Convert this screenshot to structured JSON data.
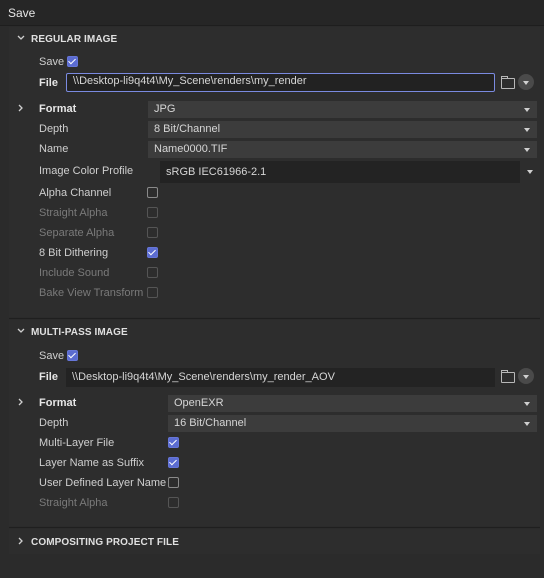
{
  "title": "Save",
  "regular": {
    "heading": "REGULAR IMAGE",
    "save_label": "Save",
    "file_label": "File",
    "file_value": "\\\\Desktop-li9q4t4\\My_Scene\\renders\\my_render",
    "format_label": "Format",
    "format_value": "JPG",
    "depth_label": "Depth",
    "depth_value": "8 Bit/Channel",
    "name_label": "Name",
    "name_value": "Name0000.TIF",
    "profile_label": "Image Color Profile",
    "profile_value": "sRGB IEC61966-2.1",
    "alpha_channel": "Alpha Channel",
    "straight_alpha": "Straight Alpha",
    "separate_alpha": "Separate Alpha",
    "dithering": "8 Bit Dithering",
    "include_sound": "Include Sound",
    "bake_view": "Bake View Transform"
  },
  "multipass": {
    "heading": "MULTI-PASS IMAGE",
    "save_label": "Save",
    "file_label": "File",
    "file_value": "\\\\Desktop-li9q4t4\\My_Scene\\renders\\my_render_AOV",
    "format_label": "Format",
    "format_value": "OpenEXR",
    "depth_label": "Depth",
    "depth_value": "16 Bit/Channel",
    "multilayer": "Multi-Layer File",
    "layer_suffix": "Layer Name as Suffix",
    "user_layer": "User Defined Layer Name",
    "straight_alpha": "Straight Alpha"
  },
  "compositing": {
    "heading": "COMPOSITING PROJECT FILE"
  },
  "state": {
    "regular_save": true,
    "alpha_channel": false,
    "straight_alpha": false,
    "separate_alpha": false,
    "dithering": true,
    "include_sound": false,
    "bake_view": false,
    "multipass_save": true,
    "multilayer": true,
    "layer_suffix": true,
    "user_layer": false,
    "mp_straight_alpha": false
  },
  "colors": {
    "accent": "#5b6cd1",
    "field_focus_border": "#7a8ae0"
  },
  "icons": [
    "chevron-down-icon",
    "chevron-right-icon",
    "folder-icon",
    "dropdown-arrow-icon"
  ]
}
